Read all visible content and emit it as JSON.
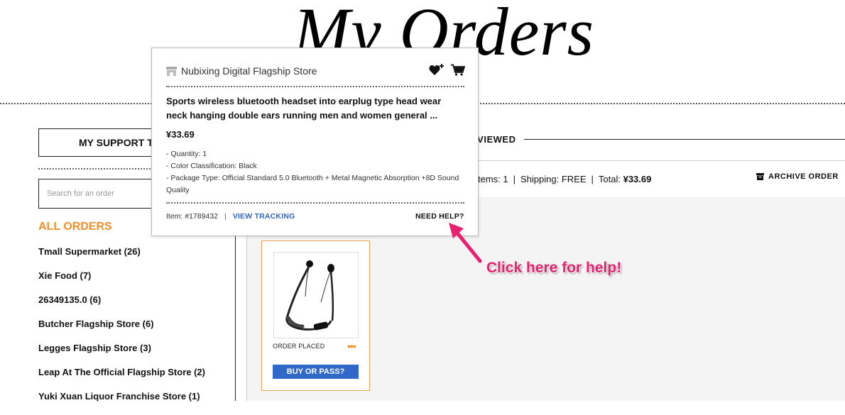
{
  "page": {
    "title": "My Orders"
  },
  "sidebar": {
    "support_button": "MY SUPPORT TI",
    "search_placeholder": "Search for an order",
    "all_orders_label": "ALL ORDERS",
    "stores": [
      "Tmall Supermarket (26)",
      "Xie Food (7)",
      "26349135.0 (6)",
      "Butcher Flagship Store (6)",
      "Legges Flagship Store (3)",
      "Leap At The Official Flagship Store (2)",
      "Yuki Xuan Liquor Franchise Store (1)"
    ]
  },
  "main": {
    "tab_reviewed": "EVIEWED",
    "summary": {
      "items": "tems: 1",
      "shipping_label": "Shipping: ",
      "shipping_value": "FREE",
      "total_label": "Total: ",
      "total_value": "¥33.69"
    },
    "archive_label": "ARCHIVE ORDER",
    "card": {
      "status": "ORDER PLACED",
      "more": "•••",
      "button": "BUY OR PASS?"
    }
  },
  "popup": {
    "store": "Nubixing Digital Flagship Store",
    "title": "Sports wireless bluetooth headset into earplug type head wear neck hanging double ears running men and women general ...",
    "price": "¥33.69",
    "details": [
      "- Quantity: 1",
      "- Color Classification: Black",
      "- Package Type: Official Standard 5.0 Bluetooth + Metal Magnetic Absorption +8D Sound Quality"
    ],
    "item_label": "Item: #1789432",
    "divider": "|",
    "view_tracking": "VIEW TRACKING",
    "need_help": "NEED HELP?"
  },
  "annotation": {
    "callout": "Click here for help!",
    "color": "#e8206f"
  },
  "colors": {
    "accent_orange": "#f0912f",
    "link_blue": "#3068c7"
  }
}
